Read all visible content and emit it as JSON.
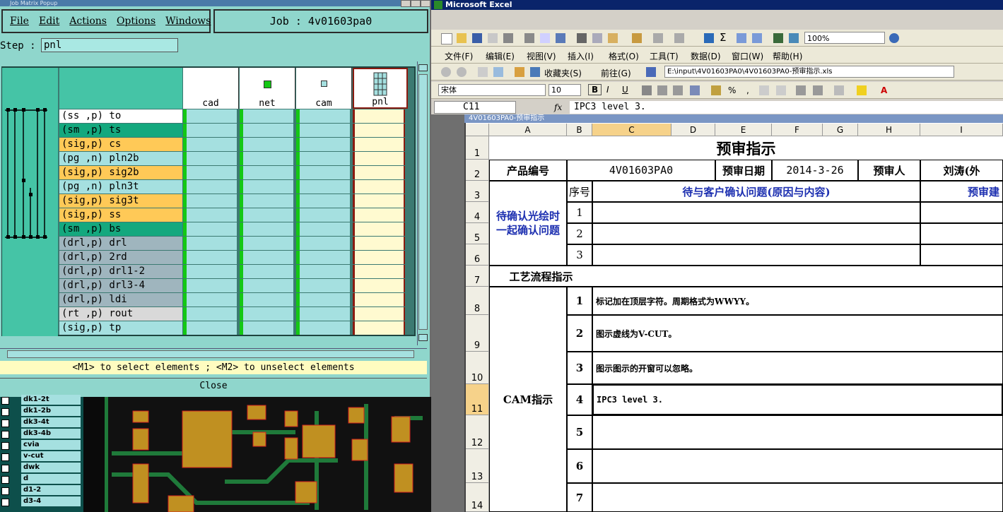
{
  "job_matrix": {
    "window_title": "Job Matrix Popup",
    "menus": [
      "File",
      "Edit",
      "Actions",
      "Options",
      "Windows"
    ],
    "job_label": "Job : 4v01603pa0",
    "step_label": "Step :",
    "step_value": "pnl",
    "columns": [
      "cad",
      "net",
      "cam",
      "pnl"
    ],
    "rows": [
      {
        "label": "(ss ,p) to",
        "color": "#ffffff"
      },
      {
        "label": "(sm ,p) ts",
        "color": "#14a87e"
      },
      {
        "label": "(sig,p) cs",
        "color": "#ffc957"
      },
      {
        "label": "(pg ,n) pln2b",
        "color": "#a5e0e0"
      },
      {
        "label": "(sig,p) sig2b",
        "color": "#ffc957"
      },
      {
        "label": "(pg ,n) pln3t",
        "color": "#a5e0e0"
      },
      {
        "label": "(sig,p) sig3t",
        "color": "#ffc957"
      },
      {
        "label": "(sig,p) ss",
        "color": "#ffc957"
      },
      {
        "label": "(sm ,p) bs",
        "color": "#14a87e"
      },
      {
        "label": "(drl,p) drl",
        "color": "#9fb5be"
      },
      {
        "label": "(drl,p) 2rd",
        "color": "#9fb5be"
      },
      {
        "label": "(drl,p) drl1-2",
        "color": "#9fb5be"
      },
      {
        "label": "(drl,p) drl3-4",
        "color": "#9fb5be"
      },
      {
        "label": "(drl,p) ldi",
        "color": "#9fb5be"
      },
      {
        "label": "(rt ,p) rout",
        "color": "#d9d9d9"
      },
      {
        "label": "(sig,p) tp",
        "color": "#a5e0e0"
      }
    ],
    "hint": "<M1> to select elements ; <M2> to unselect elements",
    "close_label": "Close"
  },
  "layer_list": [
    "dk1-2t",
    "dk1-2b",
    "dk3-4t",
    "dk3-4b",
    "cvia",
    "v-cut",
    "dwk",
    "d",
    "d1-2",
    "d3-4"
  ],
  "excel": {
    "app_title": "Microsoft Excel",
    "menus": [
      "文件(F)",
      "编辑(E)",
      "视图(V)",
      "插入(I)",
      "格式(O)",
      "工具(T)",
      "数据(D)",
      "窗口(W)",
      "帮助(H)"
    ],
    "zoom": "100%",
    "favorites_label": "收藏夹(S)",
    "goto_label": "前往(G)",
    "path": "E:\\input\\4V01603PA0\\4V01603PA0-预审指示.xls",
    "font_name": "宋体",
    "font_size": "10",
    "name_box": "C11",
    "fx": "fx",
    "formula": "IPC3 level 3.",
    "sheet_title": "4V01603PA0-预审指示",
    "col_headers": [
      "A",
      "B",
      "C",
      "D",
      "E",
      "F",
      "G",
      "H",
      "I"
    ],
    "row_headers": [
      "1",
      "2",
      "3",
      "4",
      "5",
      "6",
      "7",
      "8",
      "9",
      "10",
      "11",
      "12",
      "13",
      "14"
    ],
    "cells": {
      "title": "预审指示",
      "product_no_label": "产品编号",
      "product_no": "4V01603PA0",
      "date_label": "预审日期",
      "date": "2014-3-26",
      "reviewer_label": "预审人",
      "reviewer": "刘涛(外",
      "confirm_label": "待确认光绘时一起确认问题",
      "seq_label": "序号",
      "issue_label": "待与客户确认问题(原因与内容)",
      "suggest_label": "预审建",
      "seq": [
        "1",
        "2",
        "3"
      ],
      "flow_label": "工艺流程指示",
      "cam_label": "CAM指示",
      "cam_items": [
        {
          "n": "1",
          "text": "标记加在顶层字符。周期格式为WWYY。"
        },
        {
          "n": "2",
          "text": "图示虚线为V-CUT。"
        },
        {
          "n": "3",
          "text": "图示图示的开窗可以忽略。"
        },
        {
          "n": "4",
          "text": "IPC3 level 3."
        },
        {
          "n": "5",
          "text": ""
        },
        {
          "n": "6",
          "text": ""
        },
        {
          "n": "7",
          "text": ""
        }
      ]
    }
  }
}
